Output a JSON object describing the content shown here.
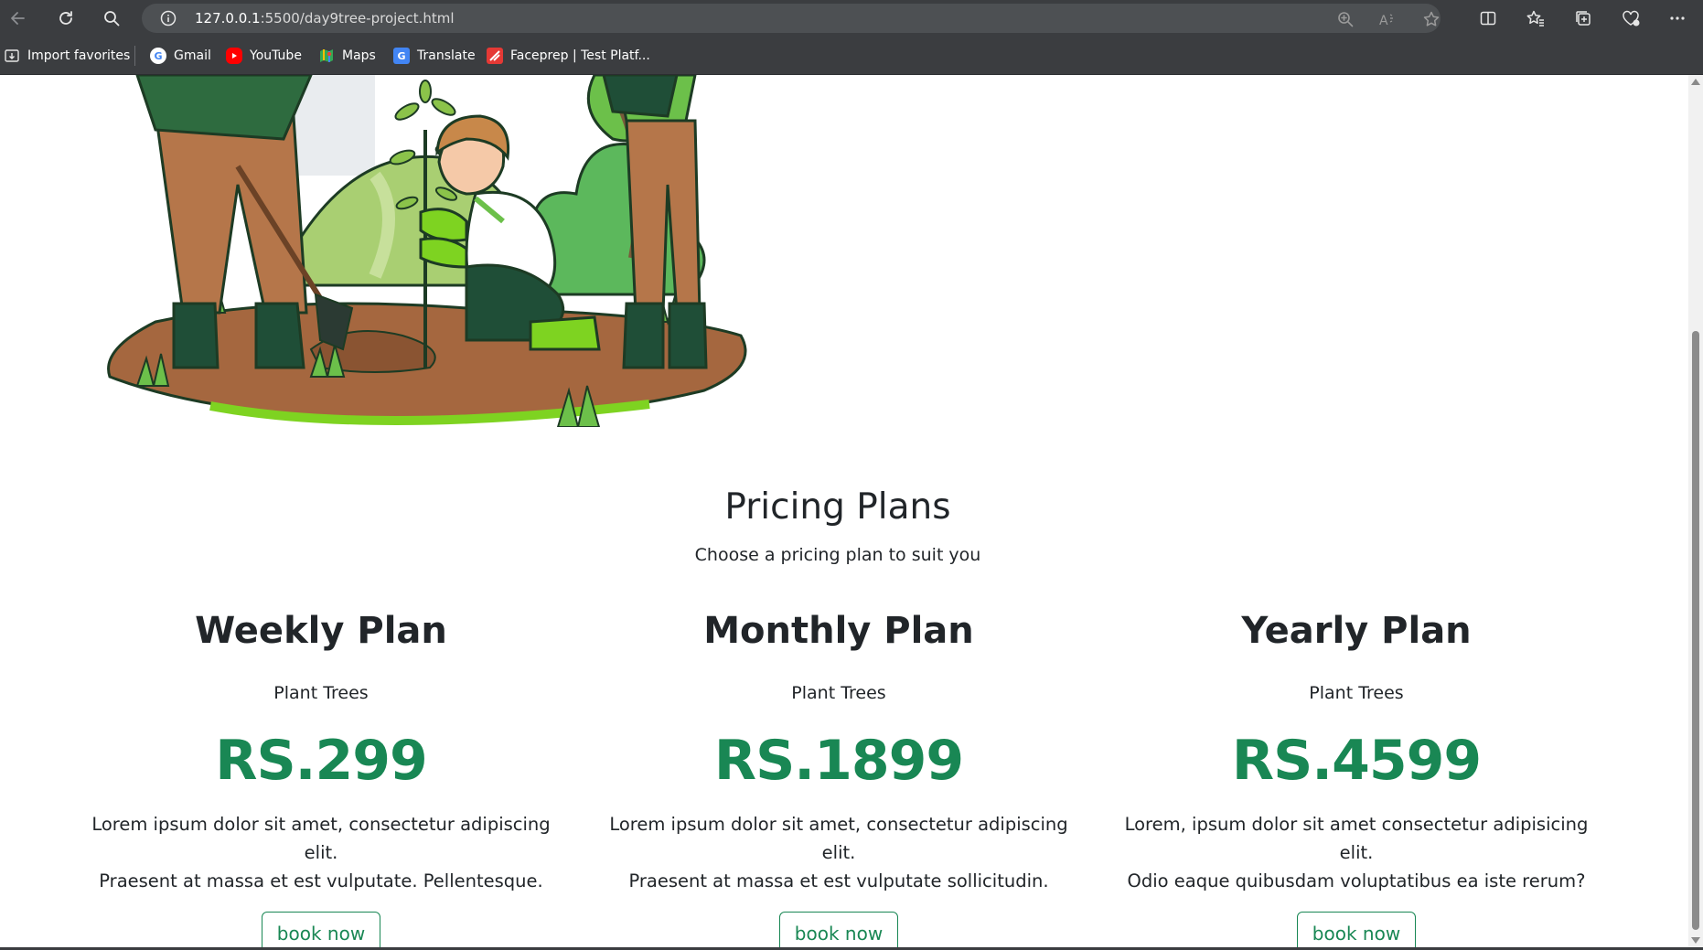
{
  "browser": {
    "url_host": "127.0.0.1",
    "url_path": ":5500/day9tree-project.html",
    "bookmarks": [
      {
        "label": "Import favorites",
        "icon": "import-icon"
      },
      {
        "label": "Gmail",
        "icon": "google-icon"
      },
      {
        "label": "YouTube",
        "icon": "youtube-icon"
      },
      {
        "label": "Maps",
        "icon": "maps-icon"
      },
      {
        "label": "Translate",
        "icon": "translate-icon"
      },
      {
        "label": "Faceprep | Test Platf...",
        "icon": "faceprep-icon"
      }
    ]
  },
  "pricing": {
    "title": "Pricing Plans",
    "subtitle": "Choose a pricing plan to suit you",
    "plans": [
      {
        "name": "Weekly Plan",
        "feature": "Plant Trees",
        "price": "RS.299",
        "desc_line1": "Lorem ipsum dolor sit amet, consectetur adipiscing elit.",
        "desc_line2": "Praesent at massa et est vulputate. Pellentesque.",
        "button": "book now"
      },
      {
        "name": "Monthly Plan",
        "feature": "Plant Trees",
        "price": "RS.1899",
        "desc_line1": "Lorem ipsum dolor sit amet, consectetur adipiscing elit.",
        "desc_line2": "Praesent at massa et est vulputate sollicitudin.",
        "button": "book now"
      },
      {
        "name": "Yearly Plan",
        "feature": "Plant Trees",
        "price": "RS.4599",
        "desc_line1": "Lorem, ipsum dolor sit amet consectetur adipisicing elit.",
        "desc_line2": "Odio eaque quibusdam voluptatibus ea iste rerum?",
        "button": "book now"
      }
    ]
  },
  "colors": {
    "accent": "#198754",
    "chrome": "#3b3d40",
    "text": "#212529"
  }
}
